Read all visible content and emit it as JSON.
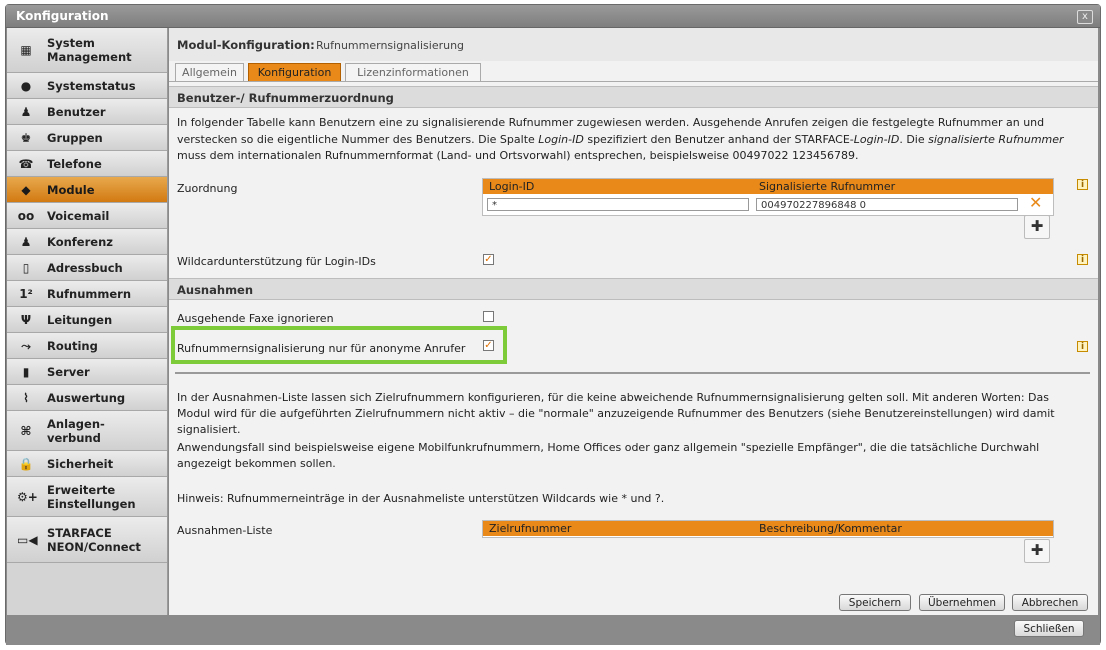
{
  "window": {
    "title": "Konfiguration",
    "close_label": "x"
  },
  "sidebar": {
    "items": [
      {
        "label": "System Management",
        "icon": "system-icon",
        "glyph": "▦",
        "active": false
      },
      {
        "label": "Systemstatus",
        "icon": "status-icon",
        "glyph": "●",
        "active": false
      },
      {
        "label": "Benutzer",
        "icon": "user-icon",
        "glyph": "♟",
        "active": false
      },
      {
        "label": "Gruppen",
        "icon": "group-icon",
        "glyph": "♚",
        "active": false
      },
      {
        "label": "Telefone",
        "icon": "phone-icon",
        "glyph": "☎",
        "active": false
      },
      {
        "label": "Module",
        "icon": "module-icon",
        "glyph": "◆",
        "active": true
      },
      {
        "label": "Voicemail",
        "icon": "voicemail-icon",
        "glyph": "oo",
        "active": false
      },
      {
        "label": "Konferenz",
        "icon": "conference-icon",
        "glyph": "♟",
        "active": false
      },
      {
        "label": "Adressbuch",
        "icon": "addressbook-icon",
        "glyph": "▯",
        "active": false
      },
      {
        "label": "Rufnummern",
        "icon": "numbers-icon",
        "glyph": "1²",
        "active": false
      },
      {
        "label": "Leitungen",
        "icon": "lines-icon",
        "glyph": "Ψ",
        "active": false
      },
      {
        "label": "Routing",
        "icon": "routing-icon",
        "glyph": "⤳",
        "active": false
      },
      {
        "label": "Server",
        "icon": "server-icon",
        "glyph": "▮",
        "active": false
      },
      {
        "label": "Auswertung",
        "icon": "chart-icon",
        "glyph": "⌇",
        "active": false
      },
      {
        "label": "Anlagen-verbund",
        "icon": "network-icon",
        "glyph": "⌘",
        "active": false
      },
      {
        "label": "Sicherheit",
        "icon": "lock-icon",
        "glyph": "🔒",
        "active": false
      },
      {
        "label": "Erweiterte Einstellungen",
        "icon": "settings-icon",
        "glyph": "⚙+",
        "active": false
      },
      {
        "label": "STARFACE NEON/Connect",
        "icon": "video-icon",
        "glyph": "▭◀",
        "active": false
      }
    ]
  },
  "module": {
    "heading_key": "Modul-Konfiguration:",
    "heading_value": "Rufnummernsignalisierung"
  },
  "tabs": [
    {
      "label": "Allgemein",
      "active": false
    },
    {
      "label": "Konfiguration",
      "active": true
    },
    {
      "label": "Lizenzinformationen",
      "active": false
    }
  ],
  "section1": {
    "title": "Benutzer-/ Rufnummerzuordnung",
    "desc_line1": "In folgender Tabelle kann Benutzern eine zu signalisierende Rufnummer zugewiesen werden. Ausgehende Anrufen zeigen die festgelegte Rufnummer an und",
    "desc_line2": "verstecken so die eigentliche Nummer des Benutzers. Die Spalte Login-ID spezifiziert den Benutzer anhand der STARFACE-Login-ID. Die signalisierte Rufnummer",
    "desc_line3": "muss dem internationalen Rufnummernformat (Land- und Ortsvorwahl) entsprechen, beispielsweise 00497022 123456789.",
    "assignment_label": "Zuordnung",
    "col_login": "Login-ID",
    "col_number": "Signalisierte Rufnummer",
    "row_login": "*",
    "row_number": "004970227896848 0",
    "wildcard_label": "Wildcardunterstützung für Login-IDs",
    "wildcard_checked": true
  },
  "section2": {
    "title": "Ausnahmen",
    "fax_label": "Ausgehende Faxe ignorieren",
    "fax_checked": false,
    "anon_label": "Rufnummernsignalisierung nur für anonyme Anrufer",
    "anon_checked": true,
    "desc_line1": "In der Ausnahmen-Liste lassen sich Zielrufnummern konfigurieren, für die keine abweichende Rufnummernsignalisierung gelten soll. Mit anderen Worten: Das",
    "desc_line2": "Modul wird für die aufgeführten Zielrufnummern nicht aktiv – die \"normale\" anzuzeigende Rufnummer des Benutzers (siehe Benutzereinstellungen) wird damit",
    "desc_line3": "signalisiert.",
    "desc_line4": "Anwendungsfall sind beispielsweise eigene Mobilfunkrufnummern, Home Offices oder ganz allgemein \"spezielle Empfänger\", die die tatsächliche Durchwahl",
    "desc_line5": "angezeigt bekommen sollen.",
    "hint": "Hinweis: Rufnummerneinträge in der Ausnahmeliste unterstützen Wildcards wie * und ?.",
    "list_label": "Ausnahmen-Liste",
    "col_target": "Zielrufnummer",
    "col_comment": "Beschreibung/Kommentar"
  },
  "buttons": {
    "save": "Speichern",
    "apply": "Übernehmen",
    "cancel": "Abbrechen",
    "close": "Schließen"
  },
  "colors": {
    "accent": "#e8891a",
    "highlight": "#7ecb3a"
  }
}
